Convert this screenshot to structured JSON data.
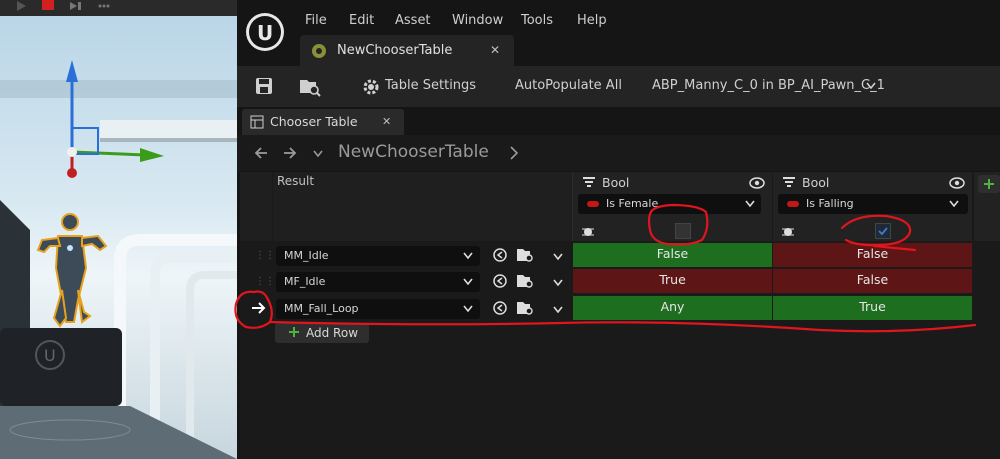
{
  "menu": [
    "File",
    "Edit",
    "Asset",
    "Window",
    "Tools",
    "Help"
  ],
  "document_tab": {
    "label": "NewChooserTable",
    "close": "✕"
  },
  "toolbar": {
    "table_settings": "Table Settings",
    "autopopulate": "AutoPopulate All",
    "debug_target": "ABP_Manny_C_0 in BP_AI_Pawn_C_1"
  },
  "panel_tab": {
    "label": "Chooser Table",
    "close": "✕"
  },
  "breadcrumb": {
    "title": "NewChooserTable"
  },
  "table": {
    "result_header": "Result",
    "columns": [
      {
        "type": "Bool",
        "property": "Is Female"
      },
      {
        "type": "Bool",
        "property": "Is Falling"
      }
    ],
    "rows": [
      {
        "result": "MM_Idle",
        "values": [
          "False",
          "False"
        ],
        "colors": [
          "green",
          "red"
        ],
        "active": false
      },
      {
        "result": "MF_Idle",
        "values": [
          "True",
          "False"
        ],
        "colors": [
          "red",
          "red"
        ],
        "active": false
      },
      {
        "result": "MM_Fall_Loop",
        "values": [
          "Any",
          "True"
        ],
        "colors": [
          "green",
          "green"
        ],
        "active": true
      }
    ],
    "add_row": "Add Row"
  },
  "colors": {
    "accent_green": "#1e6e1f",
    "accent_red": "#5d1515",
    "annotation_red": "#e0151d"
  }
}
